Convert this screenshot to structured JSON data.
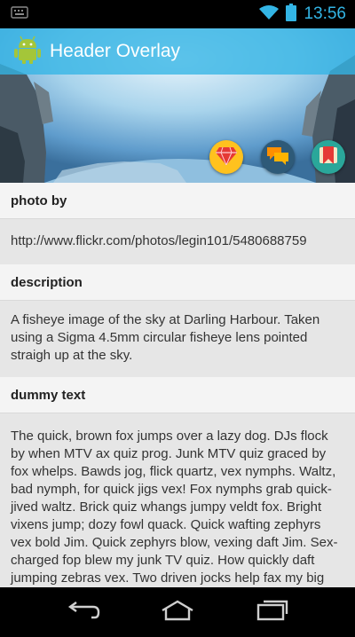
{
  "status": {
    "time": "13:56"
  },
  "app": {
    "title": "Header Overlay"
  },
  "colors": {
    "accent": "#33b5e5",
    "action_bar": "#33b5e5",
    "fab_gem": "#ffc21e",
    "fab_chat": "#2e5a78",
    "fab_bookmark": "#2aa79a"
  },
  "icons": {
    "status": [
      "keyboard-icon",
      "wifi-icon",
      "battery-icon"
    ],
    "app": "android-app-icon",
    "fabs": [
      "gem-icon",
      "chat-icon",
      "bookmark-icon"
    ],
    "nav": [
      "back-icon",
      "home-icon",
      "recents-icon"
    ]
  },
  "sections": [
    {
      "header": "photo by",
      "body": "http://www.flickr.com/photos/legin101/5480688759"
    },
    {
      "header": "description",
      "body": "A fisheye image of the sky at Darling Harbour. Taken using a Sigma 4.5mm circular fisheye lens pointed straigh up at the sky."
    },
    {
      "header": "dummy text",
      "body": "The quick, brown fox jumps over a lazy dog. DJs flock by when MTV ax quiz prog. Junk MTV quiz graced by fox whelps. Bawds jog, flick quartz, vex nymphs. Waltz, bad nymph, for quick jigs vex! Fox nymphs grab quick-jived waltz. Brick quiz whangs jumpy veldt fox. Bright vixens jump; dozy fowl quack. Quick wafting zephyrs vex bold Jim. Quick zephyrs blow, vexing daft Jim. Sex-charged fop blew my junk TV quiz. How quickly daft jumping zebras vex. Two driven jocks help fax my big quiz. Quick, Baz, get my woven flax jodhpurs! Now fax quiz Jack! my brave ghost pled."
    }
  ]
}
